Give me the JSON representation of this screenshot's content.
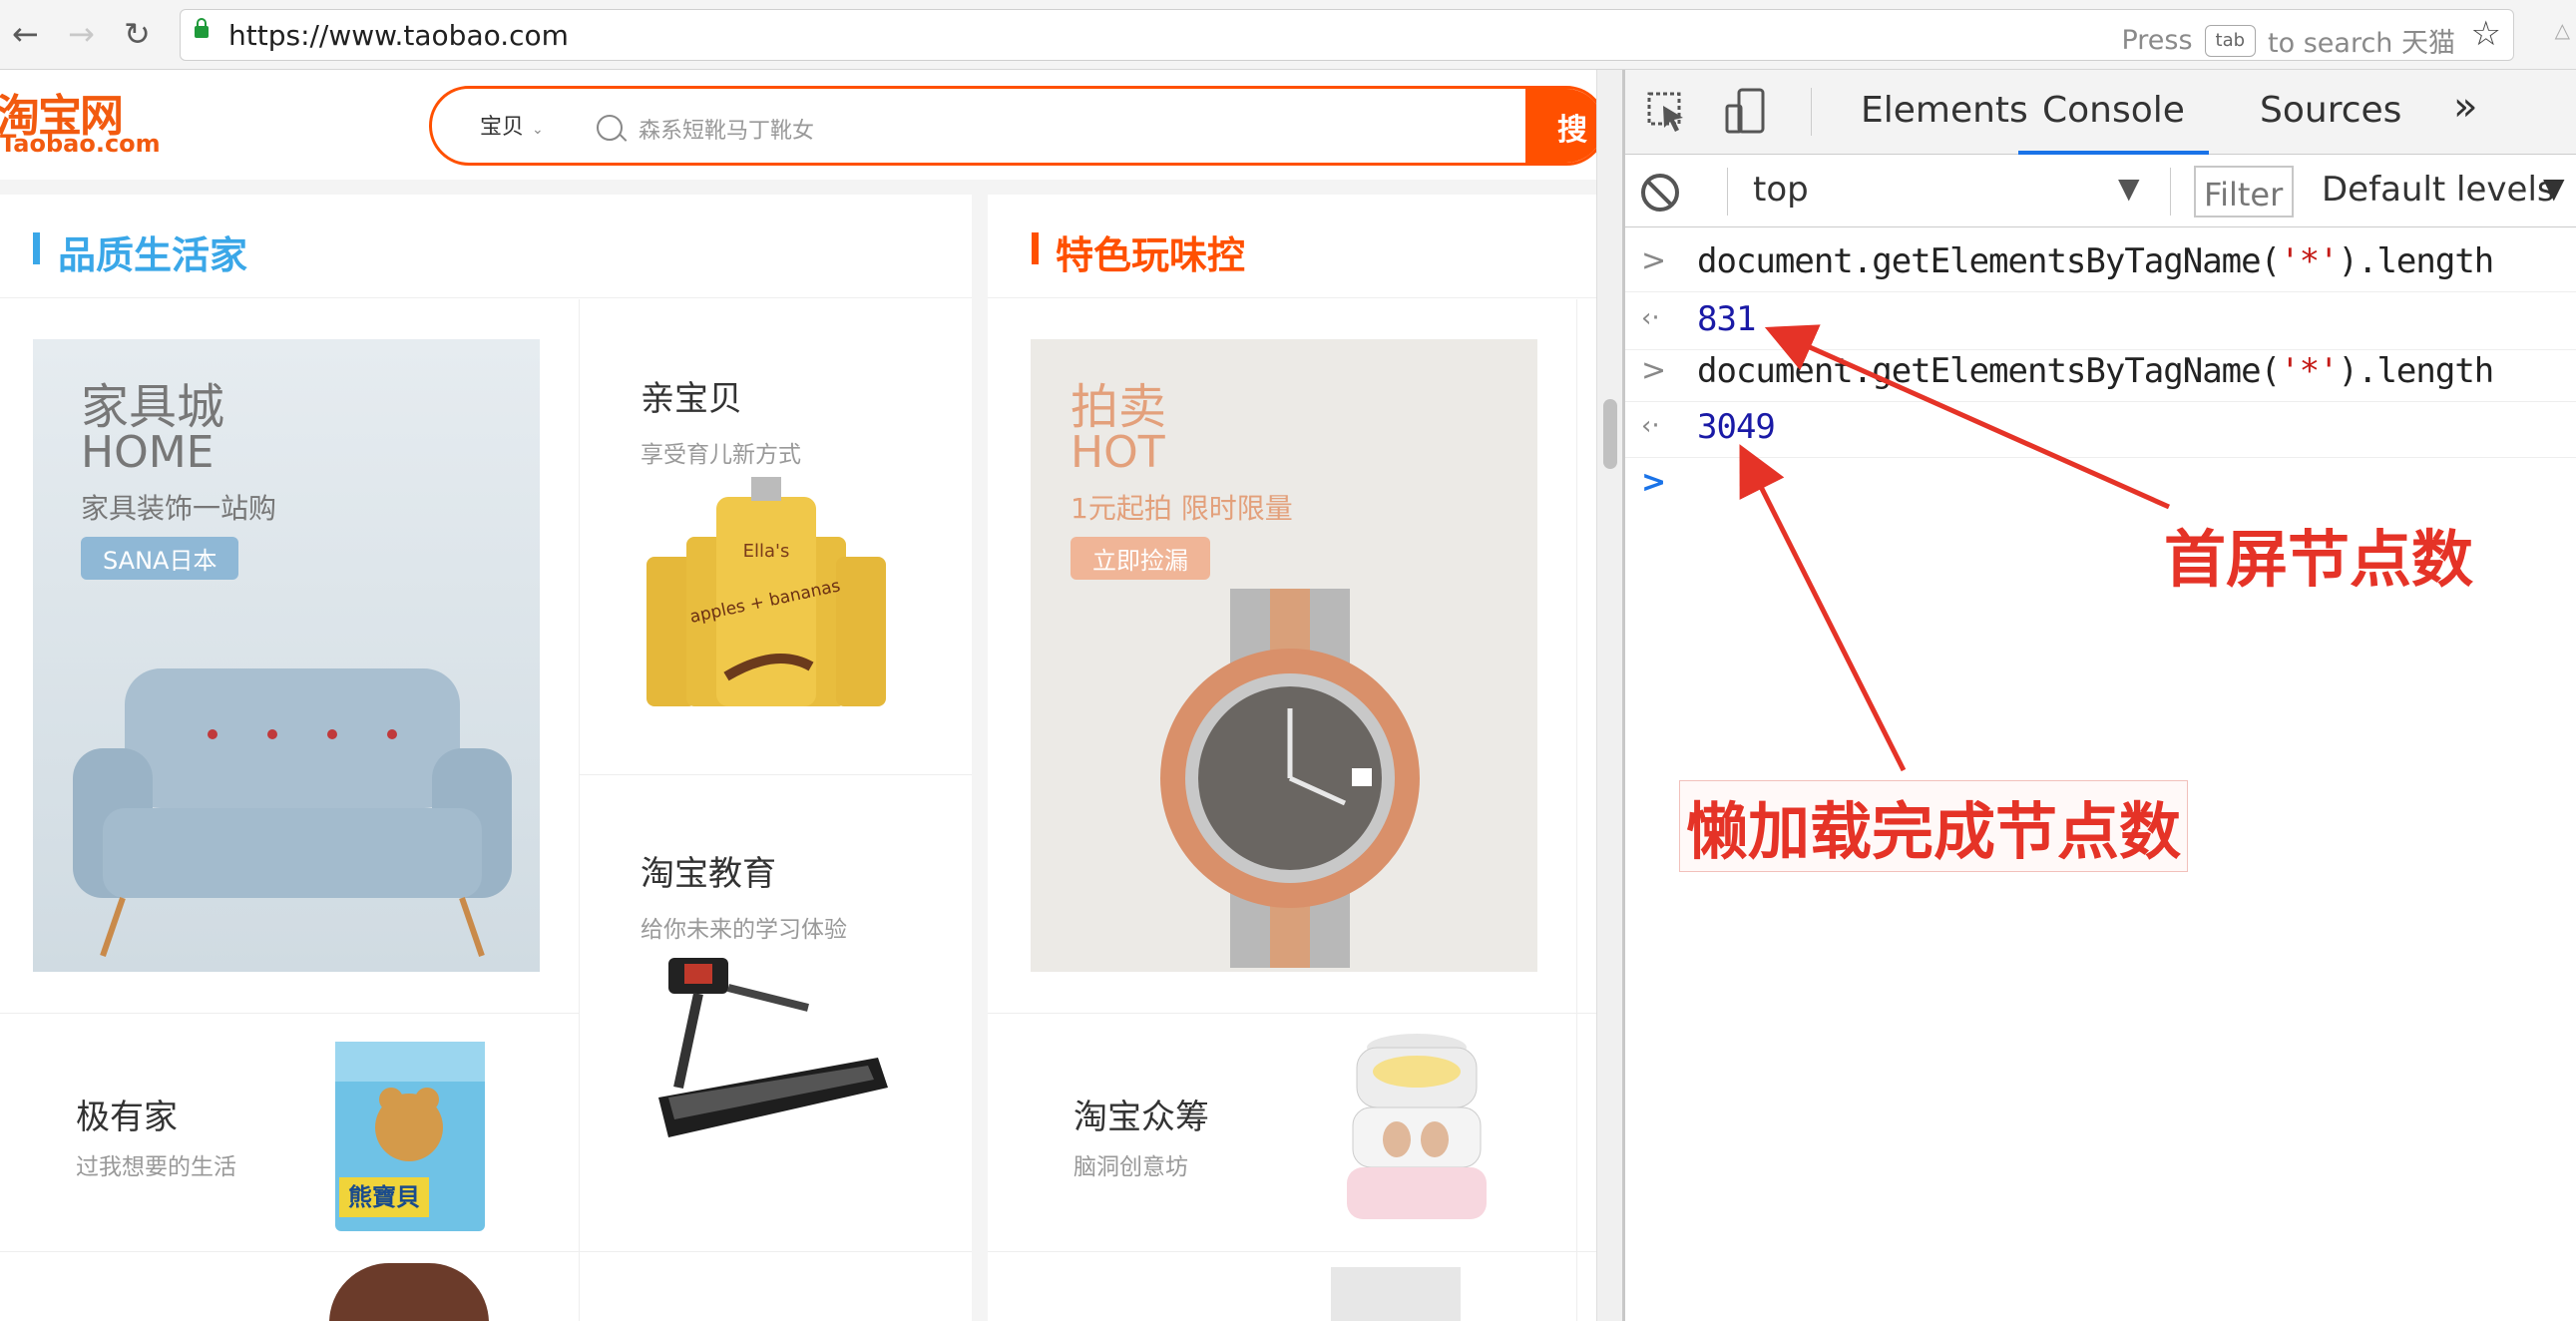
{
  "browser": {
    "url": "https://www.taobao.com",
    "search_hint_press": "Press",
    "search_hint_key": "tab",
    "search_hint_text": "to search 天猫"
  },
  "taobao": {
    "logo_cn": "淘宝网",
    "logo_en": "Taobao.com",
    "search_category": "宝贝",
    "search_placeholder": "森系短靴马丁靴女",
    "search_button": "搜",
    "sections": [
      {
        "title": "品质生活家",
        "color": "#3aa7e8"
      },
      {
        "title": "特色玩味控",
        "color": "#ff5000"
      }
    ],
    "banners": [
      {
        "l1": "家具城",
        "l2": "HOME",
        "l3": "家具装饰一站购",
        "badge": "SANA日本"
      },
      {
        "l1": "拍卖",
        "l2": "HOT",
        "l3": "1元起拍 限时限量",
        "badge": "立即捡漏"
      }
    ],
    "cards": [
      {
        "title": "亲宝贝",
        "sub": "享受育儿新方式"
      },
      {
        "title": "淘宝教育",
        "sub": "给你未来的学习体验"
      },
      {
        "title": "极有家",
        "sub": "过我想要的生活"
      },
      {
        "title": "淘宝众筹",
        "sub": "脑洞创意坊"
      }
    ],
    "pouch_text": "apples + bananas",
    "pouch_brand": "Ella's",
    "detergent_text": "熊寶貝"
  },
  "devtools": {
    "tabs": [
      "Elements",
      "Console",
      "Sources"
    ],
    "more": "»",
    "context": "top",
    "filter_placeholder": "Filter",
    "levels": "Default levels",
    "console": [
      {
        "kind": "input",
        "prefix": "document.getElementsByTagName(",
        "arg": "'*'",
        "suffix": ").length"
      },
      {
        "kind": "output",
        "value": "831"
      },
      {
        "kind": "input",
        "prefix": "document.getElementsByTagName(",
        "arg": "'*'",
        "suffix": ").length"
      },
      {
        "kind": "output",
        "value": "3049"
      }
    ]
  },
  "annotations": {
    "first_screen": "首屏节点数",
    "lazy_loaded": "懒加载完成节点数",
    "color": "#e53327"
  }
}
